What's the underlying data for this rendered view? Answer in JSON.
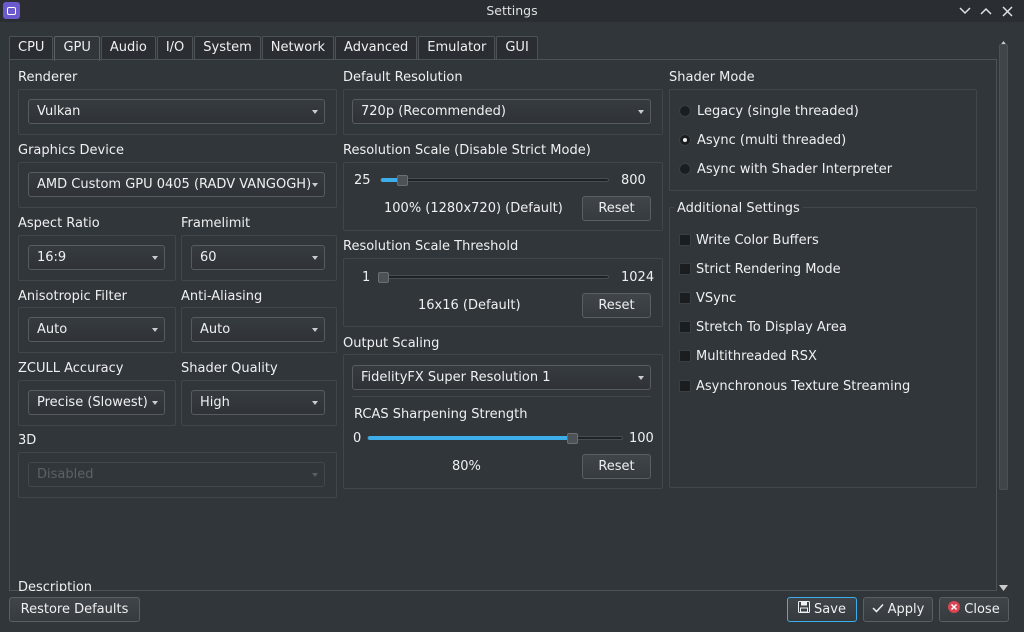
{
  "window": {
    "title": "Settings"
  },
  "tabs": [
    "CPU",
    "GPU",
    "Audio",
    "I/O",
    "System",
    "Network",
    "Advanced",
    "Emulator",
    "GUI"
  ],
  "active_tab": "GPU",
  "renderer": {
    "label": "Renderer",
    "value": "Vulkan"
  },
  "graphics_device": {
    "label": "Graphics Device",
    "value": "AMD Custom GPU 0405 (RADV VANGOGH)"
  },
  "aspect_ratio": {
    "label": "Aspect Ratio",
    "value": "16:9"
  },
  "framelimit": {
    "label": "Framelimit",
    "value": "60"
  },
  "anisotropic_filter": {
    "label": "Anisotropic Filter",
    "value": "Auto"
  },
  "anti_aliasing": {
    "label": "Anti-Aliasing",
    "value": "Auto"
  },
  "zcull_accuracy": {
    "label": "ZCULL Accuracy",
    "value": "Precise (Slowest)"
  },
  "shader_quality": {
    "label": "Shader Quality",
    "value": "High"
  },
  "three_d": {
    "label": "3D",
    "value": "Disabled"
  },
  "description_label": "Description",
  "default_resolution": {
    "label": "Default Resolution",
    "value": "720p (Recommended)"
  },
  "resolution_scale": {
    "label": "Resolution Scale (Disable Strict Mode)",
    "min": "25",
    "max": "800",
    "value": 100,
    "range": [
      25,
      800
    ],
    "value_text": "100% (1280x720) (Default)",
    "reset": "Reset"
  },
  "resolution_scale_threshold": {
    "label": "Resolution Scale Threshold",
    "min": "1",
    "max": "1024",
    "value": 16,
    "range": [
      1,
      1024
    ],
    "value_text": "16x16 (Default)",
    "reset": "Reset"
  },
  "output_scaling": {
    "label": "Output Scaling",
    "value": "FidelityFX Super Resolution 1",
    "rcas_label": "RCAS Sharpening Strength",
    "min": "0",
    "max": "100",
    "rcas_value": 80,
    "range": [
      0,
      100
    ],
    "value_text": "80%",
    "reset": "Reset"
  },
  "shader_mode": {
    "label": "Shader Mode",
    "options": [
      "Legacy (single threaded)",
      "Async (multi threaded)",
      "Async with Shader Interpreter"
    ],
    "selected": 1
  },
  "additional_settings": {
    "label": "Additional Settings",
    "items": [
      "Write Color Buffers",
      "Strict Rendering Mode",
      "VSync",
      "Stretch To Display Area",
      "Multithreaded RSX",
      "Asynchronous Texture Streaming"
    ],
    "checked": [
      false,
      false,
      false,
      false,
      false,
      false
    ]
  },
  "buttons": {
    "restore_defaults": "Restore Defaults",
    "save": "Save",
    "apply": "Apply",
    "close": "Close"
  },
  "colors": {
    "accent": "#3daee9",
    "close_icon": "#da4453",
    "background": "#31363b"
  }
}
